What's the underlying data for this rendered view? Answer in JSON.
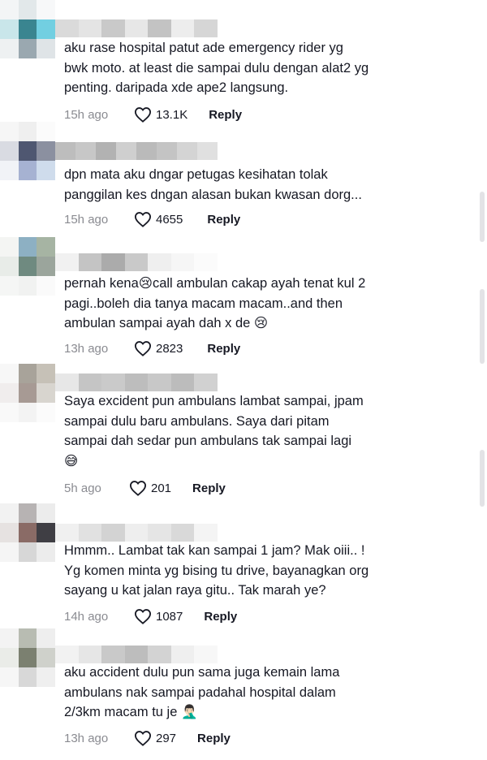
{
  "comments": [
    {
      "text": "aku rase hospital patut ade emergency rider yg\nbwk moto. at least die sampai dulu dengan alat2 yg\npenting. daripada xde ape2 langsung.",
      "time": "15h ago",
      "likes": "13.1K",
      "reply_label": "Reply",
      "avatar_colors": [
        "#f3f5f6",
        "#e2e8ea",
        "#f7f8f9",
        "#c9e6ea",
        "#3a8590",
        "#72cfe1",
        "#eef1f2",
        "#9aa8b0",
        "#dfe4e7"
      ],
      "username_colors": [
        "#dadada",
        "#e4e4e4",
        "#c9c9c9",
        "#e7e7e7",
        "#c3c3c3",
        "#ededed",
        "#d6d6d6"
      ]
    },
    {
      "text": "dpn mata aku dngar petugas kesihatan tolak\npanggilan kes dngan alasan bukan kwasan dorg...",
      "time": "15h ago",
      "likes": "4655",
      "reply_label": "Reply",
      "avatar_colors": [
        "#f6f6f6",
        "#efefef",
        "#fbfbfb",
        "#d9dbe2",
        "#4f5771",
        "#8b90a0",
        "#f1f3f7",
        "#a6b2d2",
        "#cfdcec"
      ],
      "username_colors": [
        "#bdbdbd",
        "#c7c7c7",
        "#b2b2b2",
        "#cfcfcf",
        "#bababa",
        "#c4c4c4",
        "#d4d4d4",
        "#e0e0e0"
      ]
    },
    {
      "text": "pernah kena😢call ambulan cakap ayah tenat kul 2\npagi..boleh dia tanya macam macam..and then\nambulan sampai ayah dah x de 😢",
      "time": "13h ago",
      "likes": "2823",
      "reply_label": "Reply",
      "avatar_colors": [
        "#f4f5f3",
        "#8db0c3",
        "#a6b4a3",
        "#e8ece8",
        "#6f8a80",
        "#9ba59c",
        "#f5f6f5",
        "#f1f2f1",
        "#fafafa"
      ],
      "username_colors": [
        "#f1f1f1",
        "#c4c4c4",
        "#ababab",
        "#c9c9c9",
        "#efefef",
        "#f6f6f6",
        "#fbfbfb"
      ]
    },
    {
      "text": "Saya excident pun ambulans lambat sampai, jpam\nsampai dulu baru ambulans. Saya dari pitam\nsampai dah sedar pun ambulans tak sampai lagi\n😅",
      "time": "5h ago",
      "likes": "201",
      "reply_label": "Reply",
      "avatar_colors": [
        "#f7f7f7",
        "#a8a39a",
        "#c6c1b7",
        "#f0eded",
        "#a79a94",
        "#d8d5cf",
        "#f9f9f9",
        "#f3f3f3",
        "#fbfbfb"
      ],
      "username_colors": [
        "#e7e7e7",
        "#c5c5c5",
        "#cacaca",
        "#bdbdbd",
        "#c8c8c8",
        "#bcbcbc",
        "#d1d1d1"
      ]
    },
    {
      "text": "Hmmm.. Lambat tak kan sampai 1 jam? Mak oiii.. !\nYg komen minta yg bising tu drive, bayanagkan org\nsayang u kat jalan raya gitu.. Tak marah ye?",
      "time": "14h ago",
      "likes": "1087",
      "reply_label": "Reply",
      "avatar_colors": [
        "#f2f2f2",
        "#b7b3b3",
        "#ececec",
        "#e6e2e1",
        "#8a6b66",
        "#3f3e44",
        "#f5f5f5",
        "#d7d7d7",
        "#ececec"
      ],
      "username_colors": [
        "#f0f0f0",
        "#e1e1e1",
        "#d3d3d3",
        "#eeeeee",
        "#e5e5e5",
        "#d9d9d9",
        "#f4f4f4"
      ]
    },
    {
      "text": "aku accident dulu pun sama juga kemain lama\nambulans nak sampai padahal hospital dalam\n2/3km macam tu je 🤦🏻‍♂️",
      "time": "13h ago",
      "likes": "297",
      "reply_label": "Reply",
      "avatar_colors": [
        "#f3f3f3",
        "#b8bcb2",
        "#eeeeee",
        "#eaece8",
        "#7b8070",
        "#cfd1cb",
        "#f6f6f6",
        "#d8d8d8",
        "#efefef"
      ],
      "username_colors": [
        "#f2f2f2",
        "#e6e6e6",
        "#c9c9c9",
        "#bdbdbd",
        "#d3d3d3",
        "#efefef",
        "#f7f7f7"
      ]
    }
  ],
  "colors": {
    "text": "#161823",
    "muted": "#8a8b91",
    "scrollbar": "#e3e3e6"
  },
  "icons": {
    "like": "heart-outline-icon"
  }
}
